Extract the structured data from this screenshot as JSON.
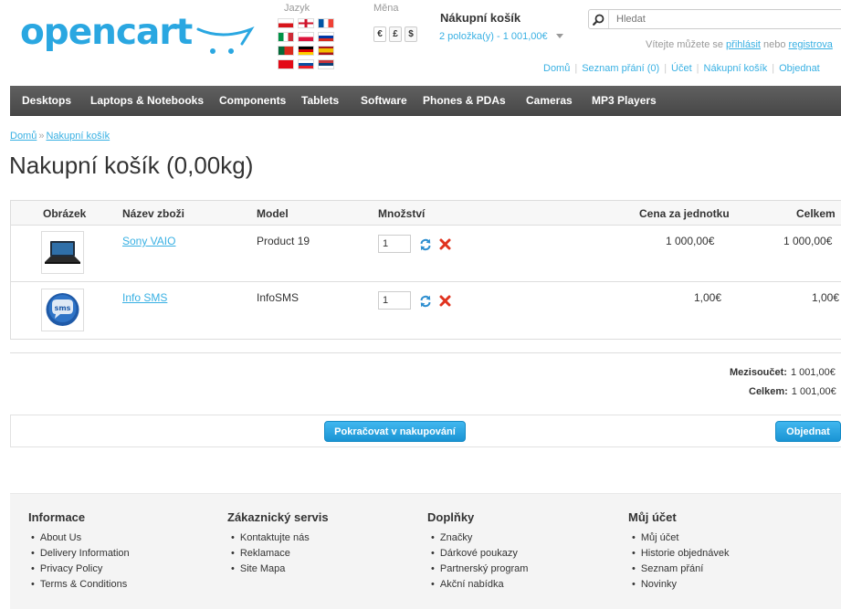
{
  "header": {
    "logo_text": "opencart",
    "language_label": "Jazyk",
    "currency_label": "Měna",
    "currencies": [
      "€",
      "£",
      "$"
    ],
    "cart_title": "Nákupní košík",
    "cart_summary": "2 položka(y) - 1 001,00€",
    "search_placeholder": "Hledat",
    "welcome_prefix": "Vítejte můžete se ",
    "login_link": "přihlásit",
    "welcome_mid": " nebo ",
    "register_link": "registrova",
    "links": [
      "Domů",
      "Seznam přání (0)",
      "Účet",
      "Nákupní košík",
      "Objednat"
    ]
  },
  "menu": [
    "Desktops",
    "Laptops & Notebooks",
    "Components",
    "Tablets",
    "Software",
    "Phones & PDAs",
    "Cameras",
    "MP3 Players"
  ],
  "breadcrumb": [
    "Domů",
    "»",
    "Nakupní košík"
  ],
  "page_title": "Nakupní košík  (0,00kg)",
  "table": {
    "headers": [
      "Obrázek",
      "Název zboži",
      "Model",
      "Množství",
      "Cena za jednotku",
      "Celkem"
    ],
    "rows": [
      {
        "name": "Sony VAIO",
        "model": "Product 19",
        "qty": "1",
        "unit_price": "1 000,00€",
        "total": "1 000,00€",
        "image_icon": "laptop-image"
      },
      {
        "name": "Info SMS",
        "model": "InfoSMS",
        "qty": "1",
        "unit_price": "1,00€",
        "total": "1,00€",
        "image_icon": "sms-bubble-image",
        "image_text": "sms"
      }
    ],
    "update_icon": "refresh-icon",
    "remove_icon": "remove-icon"
  },
  "totals": [
    {
      "label": "Mezisoučet:",
      "value": "1 001,00€"
    },
    {
      "label": "Celkem:",
      "value": "1 001,00€"
    }
  ],
  "buttons": {
    "continue": "Pokračovat v nakupování",
    "checkout": "Objednat"
  },
  "footer": [
    {
      "title": "Informace",
      "items": [
        "About Us",
        "Delivery Information",
        "Privacy Policy",
        "Terms & Conditions"
      ]
    },
    {
      "title": "Zákaznický servis",
      "items": [
        "Kontaktujte nás",
        "Reklamace",
        "Site Mapa"
      ]
    },
    {
      "title": "Doplňky",
      "items": [
        "Značky",
        "Dárkové poukazy",
        "Partnerský program",
        "Akční nabídka"
      ]
    },
    {
      "title": "Můj účet",
      "items": [
        "Můj účet",
        "Historie objednávek",
        "Seznam přání",
        "Novinky"
      ]
    }
  ],
  "colors": {
    "accent": "#38b0e3",
    "menu_bg": "#4f4f4f",
    "button": "#2aa3e2"
  }
}
